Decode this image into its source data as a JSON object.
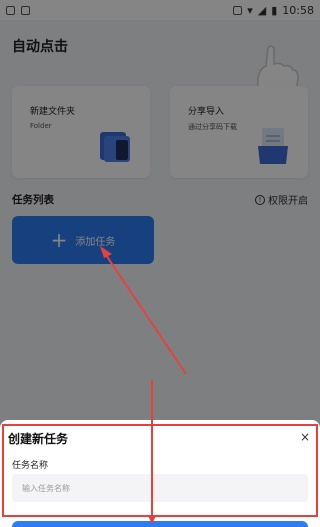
{
  "status": {
    "time": "10:58"
  },
  "page": {
    "title": "自动点击"
  },
  "cards": [
    {
      "title": "新建文件夹",
      "subtitle": "Folder"
    },
    {
      "title": "分享导入",
      "subtitle": "通过分享码下载"
    }
  ],
  "task_list": {
    "title": "任务列表",
    "permission_label": "权限开启",
    "add_label": "添加任务",
    "add_icon": "plus-icon"
  },
  "sheet": {
    "title": "创建新任务",
    "close": "×",
    "field_label": "任务名称",
    "placeholder": "输入任务名称"
  },
  "colors": {
    "accent": "#2d7cf4",
    "annotation": "#e8413c"
  }
}
